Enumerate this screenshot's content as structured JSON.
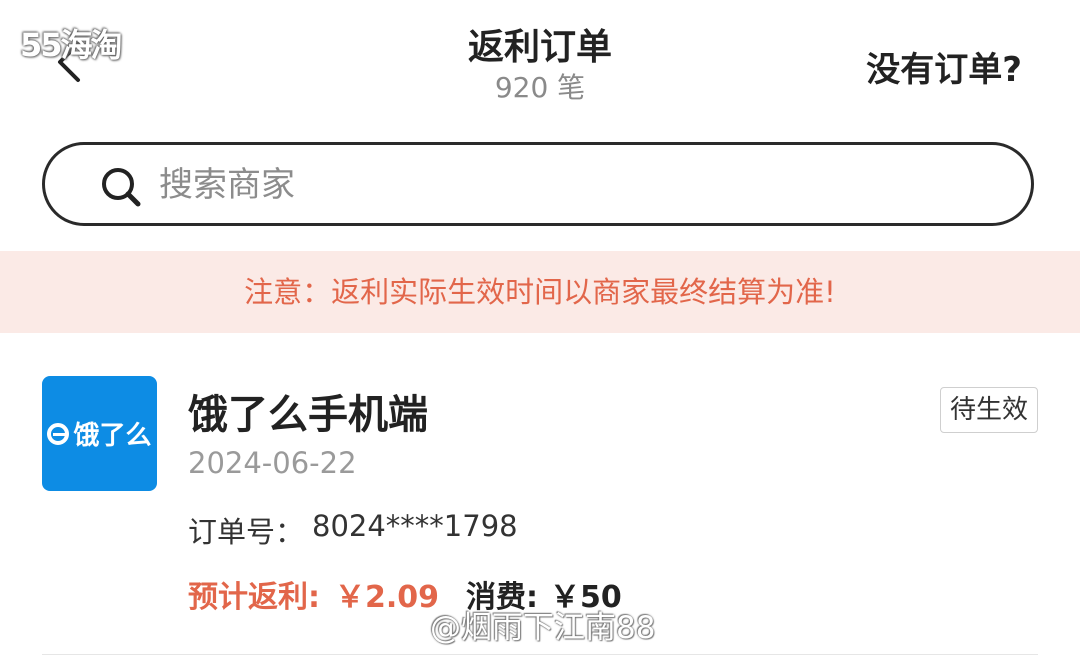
{
  "watermark_top": "55海淘",
  "header": {
    "back_icon": "chevron-left-icon",
    "title": "返利订单",
    "count_text": "920 笔",
    "no_order_link": "没有订单?"
  },
  "search": {
    "icon": "search-icon",
    "placeholder": "搜索商家",
    "value": ""
  },
  "notice": {
    "text": "注意：返利实际生效时间以商家最终结算为准!",
    "color": "#e2664a",
    "background": "#fbeae6"
  },
  "orders": [
    {
      "logo_text": "饿了么",
      "logo_color": "#0d8ce4",
      "shop_name": "饿了么手机端",
      "status": "待生效",
      "date": "2024-06-22",
      "order_no_label": "订单号：",
      "order_no": "8024****1798",
      "rebate_label": "预计返利:",
      "rebate_value": "￥2.09",
      "spend_label": "消费:",
      "spend_value": "￥50"
    }
  ],
  "watermark_bottom": "@烟雨下江南88"
}
